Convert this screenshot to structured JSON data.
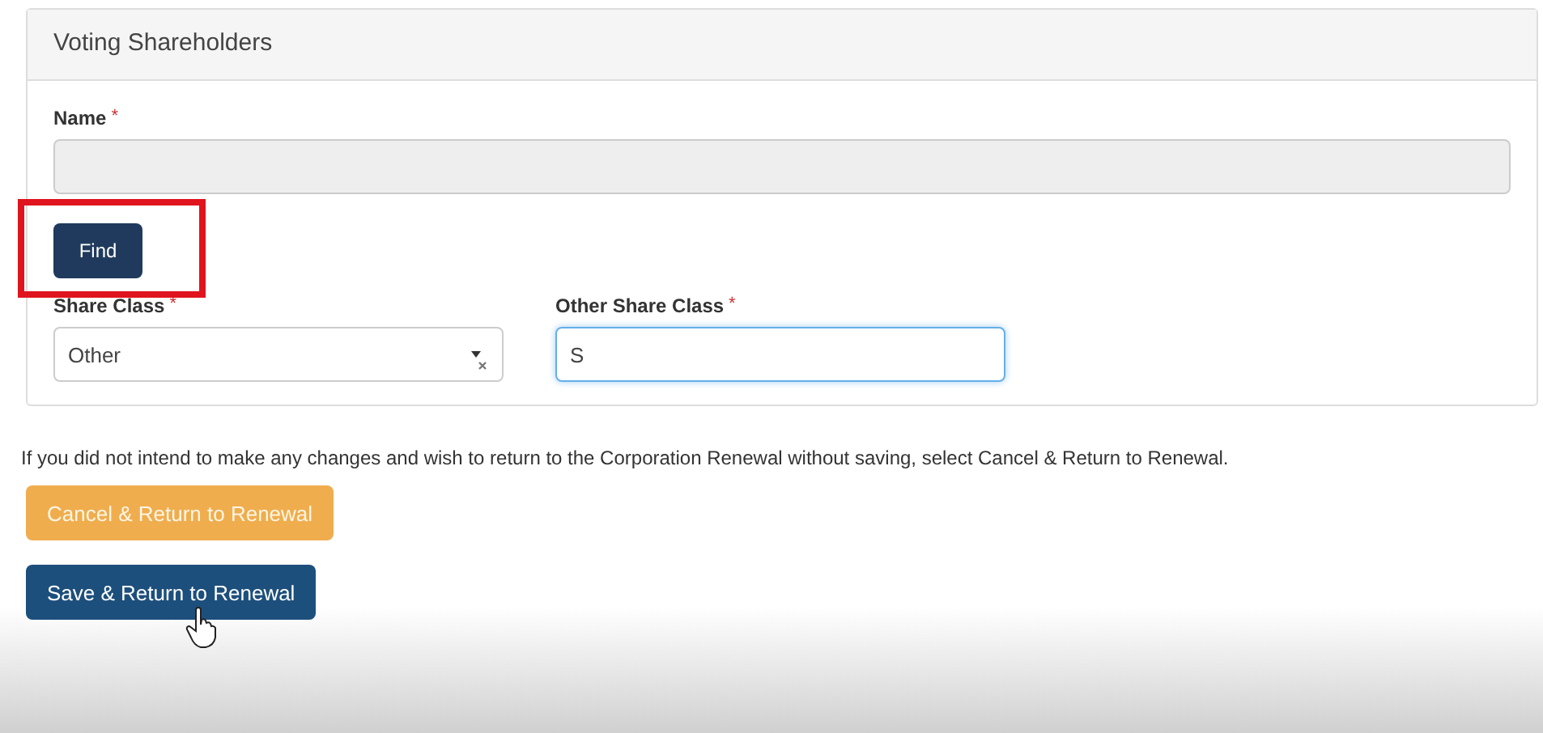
{
  "panel": {
    "title": "Voting Shareholders"
  },
  "name_field": {
    "label": "Name",
    "required_mark": "*",
    "disabled": true
  },
  "find_button": {
    "label": "Find",
    "highlighted": true
  },
  "share_class": {
    "label": "Share Class",
    "required_mark": "*",
    "value": "Other"
  },
  "other_share_class": {
    "label": "Other Share Class",
    "required_mark": "*",
    "value": "S",
    "focused": true
  },
  "notice": "If you did not intend to make any changes and wish to return to the Corporation Renewal without saving, select Cancel & Return to Renewal.",
  "buttons": [
    {
      "label": "Cancel & Return to Renewal",
      "kind": "warning",
      "hovered": false
    },
    {
      "label": "Save & Return to Renewal",
      "kind": "primary",
      "hovered": true
    }
  ]
}
